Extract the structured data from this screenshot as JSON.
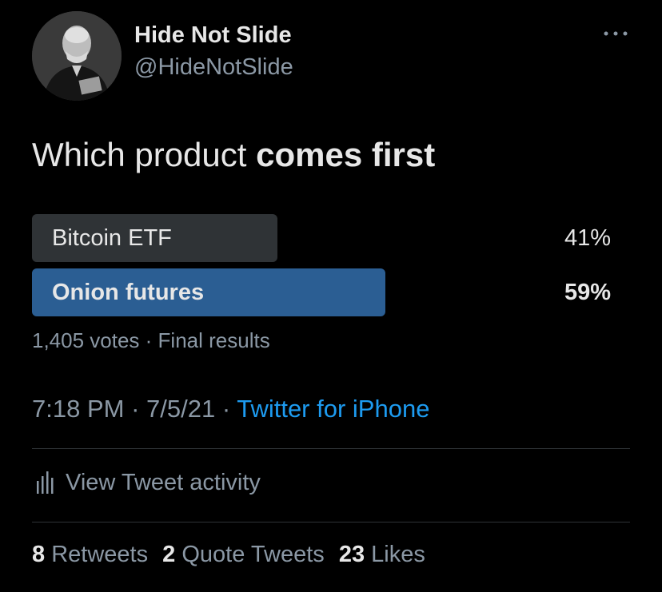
{
  "author": {
    "display_name": "Hide Not Slide",
    "handle": "@HideNotSlide"
  },
  "tweet": {
    "text_regular": "Which product ",
    "text_bold": "comes first"
  },
  "poll": {
    "options": [
      {
        "label": "Bitcoin ETF",
        "percent": "41%",
        "value": 41,
        "winner": false
      },
      {
        "label": "Onion futures",
        "percent": "59%",
        "value": 59,
        "winner": true
      }
    ],
    "votes": "1,405 votes",
    "separator": " · ",
    "status": "Final results"
  },
  "meta": {
    "time": "7:18 PM",
    "sep1": " · ",
    "date": "7/5/21",
    "sep2": " · ",
    "source": "Twitter for iPhone"
  },
  "activity": {
    "label": "View Tweet activity",
    "icon": "bar-chart-icon"
  },
  "stats": {
    "retweets_count": "8",
    "retweets_label": "Retweets",
    "quote_count": "2",
    "quote_label": "Quote Tweets",
    "likes_count": "23",
    "likes_label": "Likes"
  },
  "colors": {
    "background": "#000000",
    "winner_bar": "#2b5e93",
    "loser_bar": "#2f3336",
    "link": "#1d9bf0",
    "muted": "#8b98a5"
  }
}
